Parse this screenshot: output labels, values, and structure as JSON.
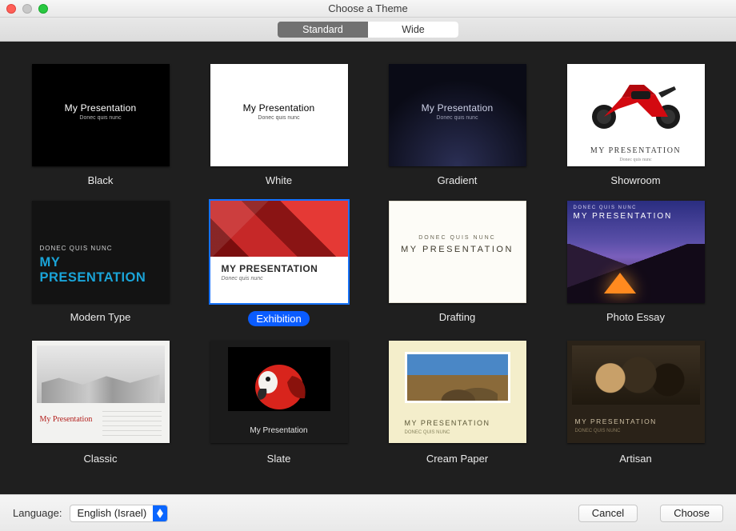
{
  "window": {
    "title": "Choose a Theme"
  },
  "tabs": {
    "standard": "Standard",
    "wide": "Wide",
    "active": "standard"
  },
  "themes": [
    {
      "id": "black",
      "label": "Black",
      "selected": false
    },
    {
      "id": "white",
      "label": "White",
      "selected": false
    },
    {
      "id": "gradient",
      "label": "Gradient",
      "selected": false
    },
    {
      "id": "showroom",
      "label": "Showroom",
      "selected": false
    },
    {
      "id": "moderntype",
      "label": "Modern Type",
      "selected": false
    },
    {
      "id": "exhibition",
      "label": "Exhibition",
      "selected": true
    },
    {
      "id": "drafting",
      "label": "Drafting",
      "selected": false
    },
    {
      "id": "photoessay",
      "label": "Photo Essay",
      "selected": false
    },
    {
      "id": "classic",
      "label": "Classic",
      "selected": false
    },
    {
      "id": "slate",
      "label": "Slate",
      "selected": false
    },
    {
      "id": "creampaper",
      "label": "Cream Paper",
      "selected": false
    },
    {
      "id": "artisan",
      "label": "Artisan",
      "selected": false
    }
  ],
  "preview_text": {
    "title": "My Presentation",
    "title_caps": "MY PRESENTATION",
    "kicker": "DONEC QUIS NUNC",
    "sub": "Donec quis nunc"
  },
  "footer": {
    "language_label": "Language:",
    "language_value": "English (Israel)",
    "cancel": "Cancel",
    "choose": "Choose"
  }
}
